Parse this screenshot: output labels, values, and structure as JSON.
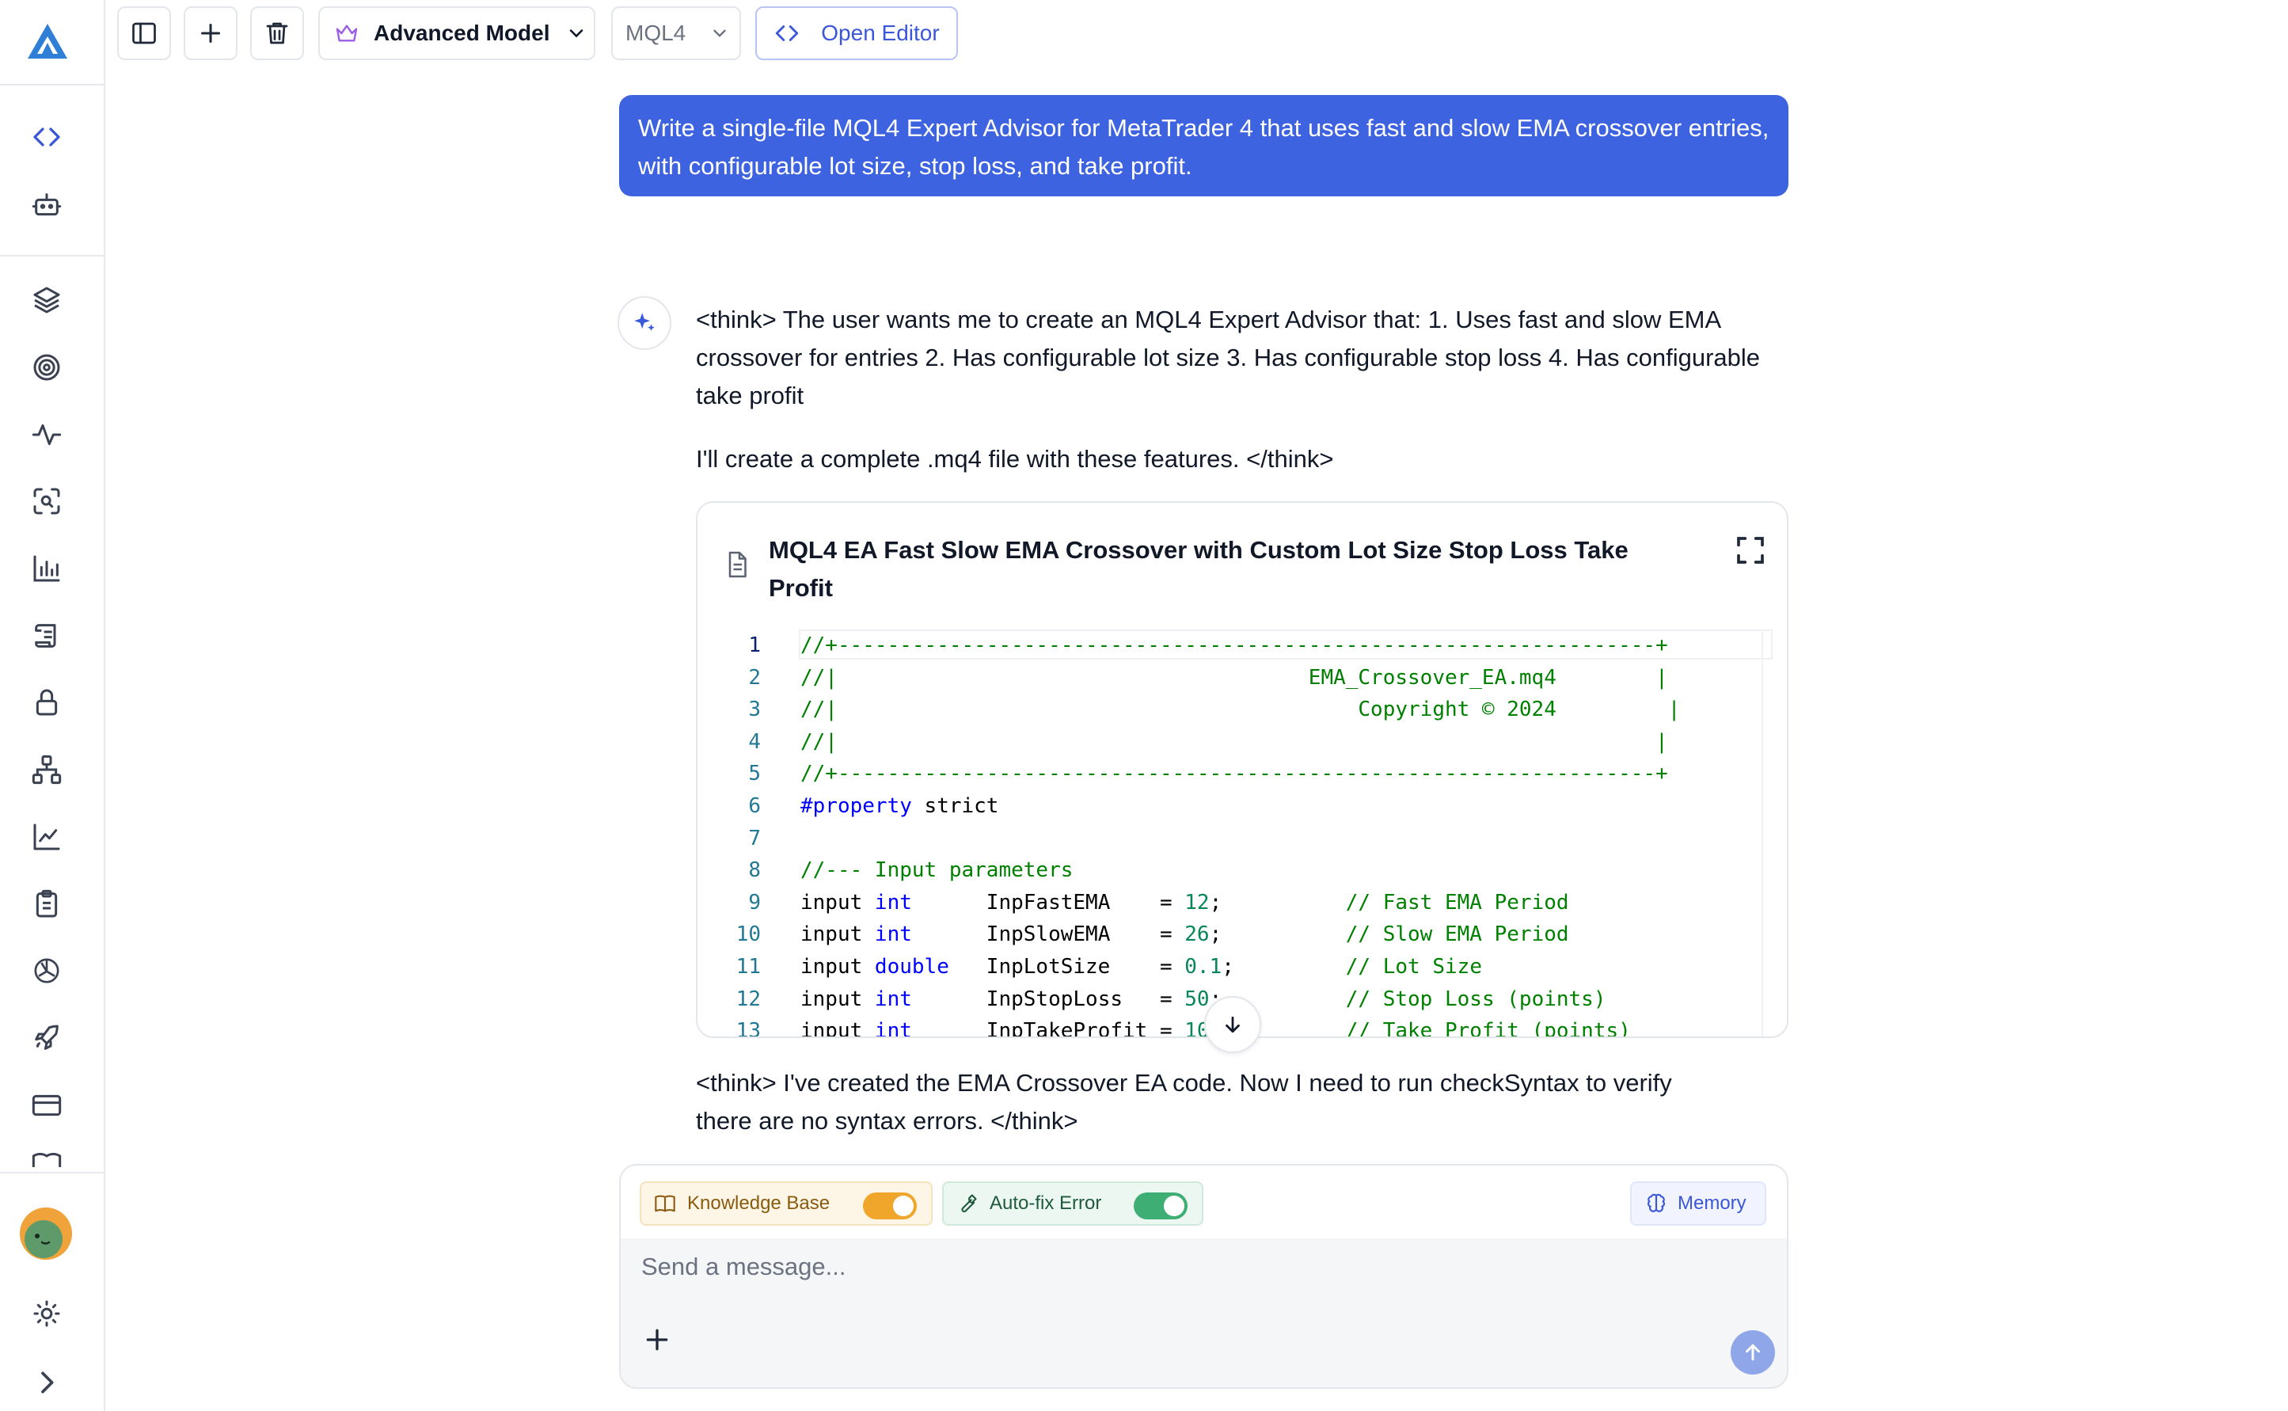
{
  "toolbar": {
    "model_label": "Advanced Model",
    "language_label": "MQL4",
    "editor_label": "Open Editor"
  },
  "chat": {
    "user_message": "Write a single-file MQL4 Expert Advisor for MetaTrader 4 that uses fast and slow EMA crossover entries, with configurable lot size, stop loss, and take profit.",
    "think_1": "<think> The user wants me to create an MQL4 Expert Advisor that: 1. Uses fast and slow EMA crossover for entries 2. Has configurable lot size 3. Has configurable stop loss 4. Has configurable take profit",
    "think_2": "I'll create a complete .mq4 file with these features. </think>",
    "think_3": "<think> I've created the EMA Crossover EA code. Now I need to run checkSyntax to verify there are no syntax errors. </think>"
  },
  "code_block": {
    "title": "MQL4 EA Fast Slow EMA Crossover with Custom Lot Size Stop Loss Take Profit",
    "lines": [
      "//+------------------------------------------------------------------+",
      "//|                                      EMA_Crossover_EA.mq4        |",
      "//|                                          Copyright © 2024         |",
      "//|                                                                  |",
      "//+------------------------------------------------------------------+",
      "#property strict",
      "",
      "//--- Input parameters",
      "input int      InpFastEMA    = 12;          // Fast EMA Period",
      "input int      InpSlowEMA    = 26;          // Slow EMA Period",
      "input double   InpLotSize    = 0.1;         // Lot Size",
      "input int      InpStopLoss   = 50;          // Stop Loss (points)",
      "input int      InpTakeProfit = 10           // Take Profit (points)"
    ]
  },
  "composer": {
    "knowledge_base_label": "Knowledge Base",
    "knowledge_base_on": true,
    "autofix_label": "Auto-fix Error",
    "autofix_on": true,
    "memory_label": "Memory",
    "placeholder": "Send a message..."
  },
  "colors": {
    "accent": "#3e63e0",
    "knowledge_toggle": "#f0a62a",
    "autofix_toggle": "#3fae74",
    "comment": "#008000",
    "keyword": "#0000ff",
    "number": "#098658"
  },
  "icons": {
    "sidebar": [
      "logo-icon",
      "code-icon",
      "bot-icon",
      "layers-icon",
      "target-icon",
      "activity-icon",
      "scan-search-icon",
      "bar-chart-icon",
      "scroll-icon",
      "lock-icon",
      "network-icon",
      "line-chart-icon",
      "clipboard-icon",
      "openai-icon",
      "rocket-icon",
      "credit-card-icon",
      "book-icon",
      "avatar",
      "settings-icon",
      "chevron-right-icon"
    ]
  }
}
